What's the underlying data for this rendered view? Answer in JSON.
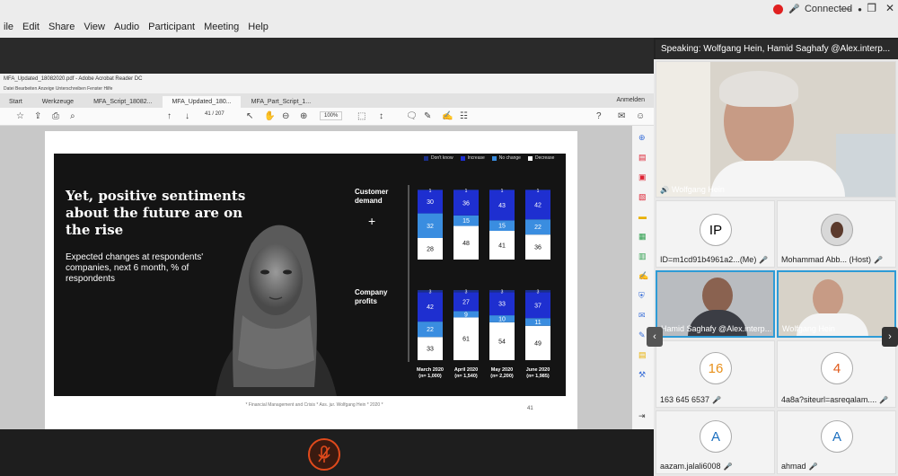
{
  "menubar": {
    "items": [
      "ile",
      "Edit",
      "Share",
      "View",
      "Audio",
      "Participant",
      "Meeting",
      "Help"
    ],
    "status": "Connected"
  },
  "acrobat": {
    "title": "MFA_Updated_18082020.pdf - Adobe Acrobat Reader DC",
    "menu": "Datei   Bearbeiten   Anzeige   Unterschreiben   Fenster   Hilfe",
    "tabs": [
      "Start",
      "Werkzeuge",
      "MFA_Script_18082...",
      "MFA_Updated_180...",
      "MFA_Part_Script_1..."
    ],
    "anmelden": "Anmelden",
    "page": "41  /  207",
    "zoom": "100%"
  },
  "slide": {
    "title": "Yet, positive sentiments about the future are on the rise",
    "subtitle": "Expected changes at respondents' companies, next 6 month, % of respondents",
    "plus": "+",
    "row_labels": [
      "Customer demand",
      "Company profits"
    ],
    "colors": {
      "dont_know": "#1a2f8a",
      "increase": "#1e2fd0",
      "no_change": "#3a8de0",
      "decrease": "#ffffff"
    }
  },
  "chart_data": {
    "type": "bar",
    "stacked": true,
    "legend": [
      "Don't know",
      "Increase",
      "No change",
      "Decrease"
    ],
    "legend_placement": "top-right",
    "categories": [
      "March 2020 (n= 1,000)",
      "April 2020 (n= 1,540)",
      "May 2020 (n= 2,200)",
      "June 2020 (n= 1,985)"
    ],
    "panels": [
      {
        "name": "Customer demand",
        "series": [
          {
            "name": "Decrease",
            "values": [
              28,
              48,
              41,
              36
            ]
          },
          {
            "name": "No change",
            "values": [
              32,
              15,
              15,
              22
            ]
          },
          {
            "name": "Increase",
            "values": [
              30,
              36,
              43,
              42
            ]
          },
          {
            "name": "Don't know",
            "values": [
              1,
              1,
              1,
              1
            ]
          }
        ]
      },
      {
        "name": "Company profits",
        "series": [
          {
            "name": "Decrease",
            "values": [
              33,
              61,
              54,
              49
            ]
          },
          {
            "name": "No change",
            "values": [
              22,
              9,
              10,
              11
            ]
          },
          {
            "name": "Increase",
            "values": [
              42,
              27,
              33,
              37
            ]
          },
          {
            "name": "Don't know",
            "values": [
              3,
              3,
              3,
              3
            ]
          }
        ]
      }
    ]
  },
  "footer": {
    "text": "* Financial Management and Crisis * Ass. jur. Wolfgang Hein * 2020 *",
    "page": "41"
  },
  "speaking": "Speaking: Wolfgang Hein, Hamid Saghafy @Alex.interp...",
  "participants": [
    {
      "name": "Wolfgang Hein"
    },
    {
      "name": "ID=m1cd91b4961a2...(Me)",
      "initials": "IP"
    },
    {
      "name": "Mohammad Abb... (Host)"
    },
    {
      "name": "Hamid Saghafy @Alex.interp..."
    },
    {
      "name": "Wolfgang Hein"
    },
    {
      "name": "163 645 6537",
      "initials": "16"
    },
    {
      "name": "4a8a?siteurl=asreqalam....",
      "initials": "4"
    },
    {
      "name": "aazam.jalali6008",
      "initials": "A"
    },
    {
      "name": "ahmad",
      "initials": "A"
    }
  ]
}
